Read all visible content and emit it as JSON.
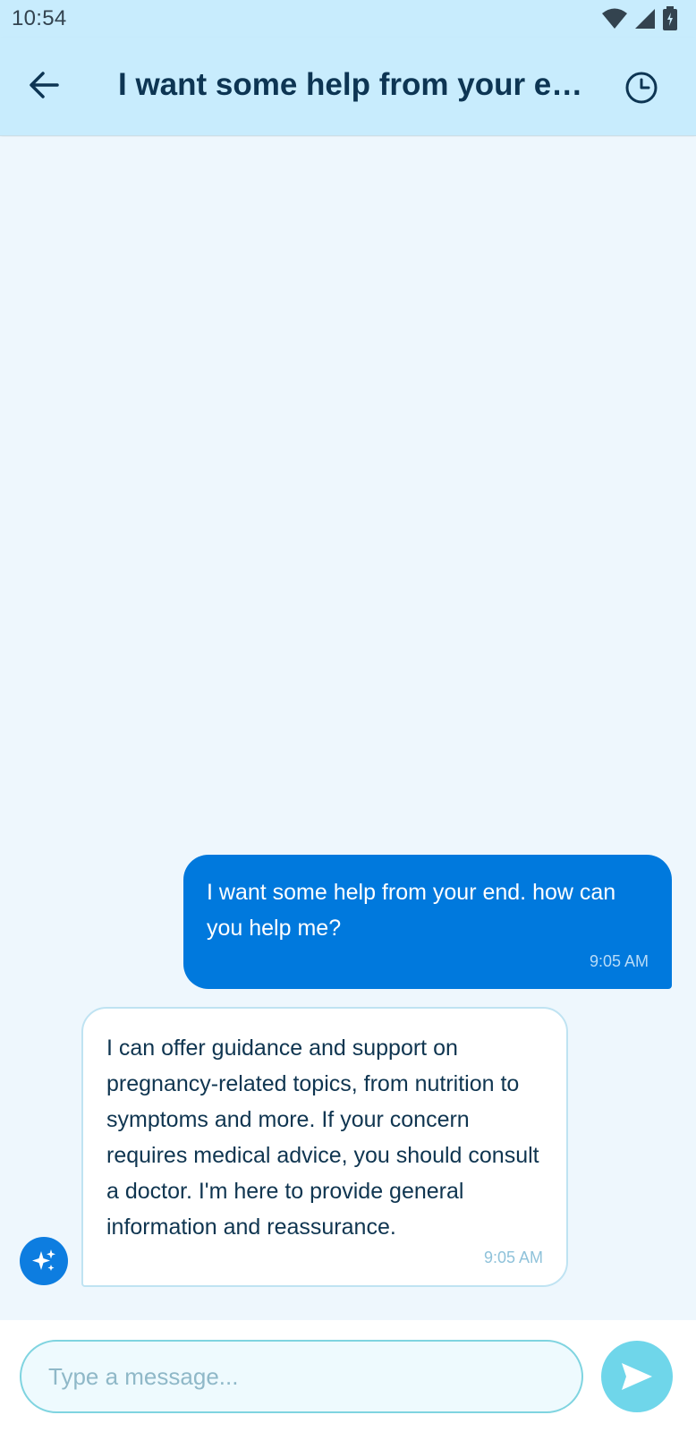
{
  "status_bar": {
    "time": "10:54",
    "icons": [
      "wifi-icon",
      "signal-icon",
      "battery-icon"
    ]
  },
  "header": {
    "title": "I want some help from your end. how can you help me?"
  },
  "messages": [
    {
      "sender": "user",
      "text": "I want some help from your end. how can you help me?",
      "time": "9:05 AM"
    },
    {
      "sender": "bot",
      "text": "I can offer guidance and support on pregnancy-related topics, from nutrition to symptoms and more. If your concern requires medical advice, you should consult a doctor. I'm here to provide general information and reassurance.",
      "time": "9:05 AM"
    }
  ],
  "composer": {
    "placeholder": "Type a message..."
  },
  "colors": {
    "header_bg": "#c8ecfd",
    "chat_bg": "#eef7fd",
    "user_bubble": "#0079dd",
    "send_button": "#6fd6ea"
  }
}
